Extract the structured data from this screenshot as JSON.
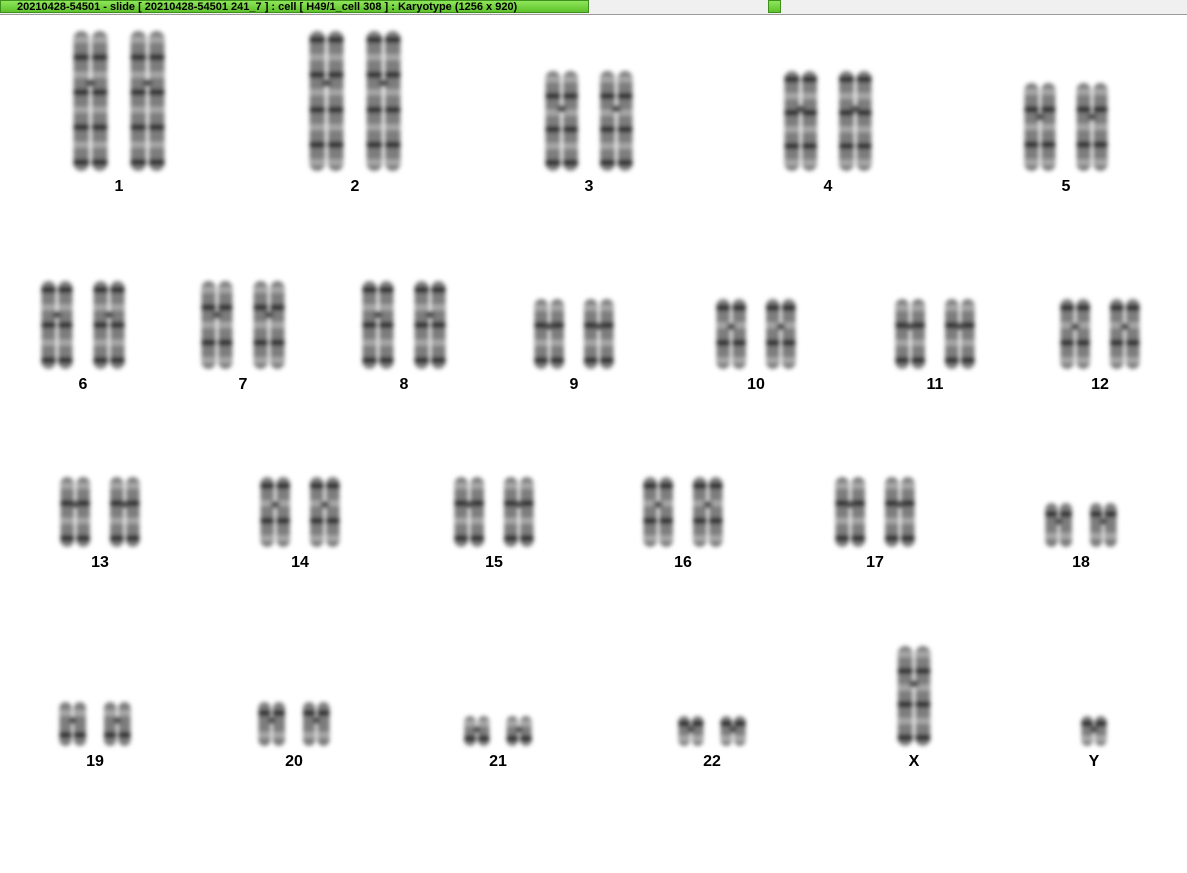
{
  "window": {
    "title": "20210428-54501 - slide [ 20210428-54501 241_7 ] : cell [ H49/1_cell 308 ] : Karyotype  (1256 x 920)"
  },
  "chromosomes": [
    {
      "label": "1",
      "size": "xl"
    },
    {
      "label": "2",
      "size": "xl"
    },
    {
      "label": "3",
      "size": "l"
    },
    {
      "label": "4",
      "size": "l"
    },
    {
      "label": "5",
      "size": "m"
    },
    {
      "label": "6",
      "size": "m"
    },
    {
      "label": "7",
      "size": "m"
    },
    {
      "label": "8",
      "size": "m"
    },
    {
      "label": "9",
      "size": "s"
    },
    {
      "label": "10",
      "size": "s"
    },
    {
      "label": "11",
      "size": "s"
    },
    {
      "label": "12",
      "size": "s"
    },
    {
      "label": "13",
      "size": "s"
    },
    {
      "label": "14",
      "size": "s"
    },
    {
      "label": "15",
      "size": "s"
    },
    {
      "label": "16",
      "size": "s"
    },
    {
      "label": "17",
      "size": "s"
    },
    {
      "label": "18",
      "size": "xs"
    },
    {
      "label": "19",
      "size": "xs"
    },
    {
      "label": "20",
      "size": "xs"
    },
    {
      "label": "21",
      "size": "xxs"
    },
    {
      "label": "22",
      "size": "xxs"
    },
    {
      "label": "X",
      "size": "l"
    },
    {
      "label": "Y",
      "size": "xxs"
    }
  ]
}
